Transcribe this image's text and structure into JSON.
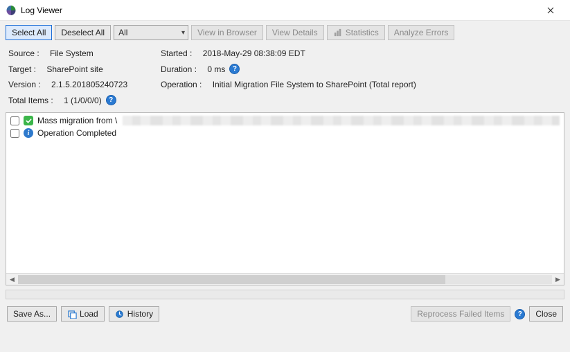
{
  "window": {
    "title": "Log Viewer"
  },
  "toolbar": {
    "select_all": "Select All",
    "deselect_all": "Deselect All",
    "filter_value": "All",
    "view_browser": "View in Browser",
    "view_details": "View Details",
    "statistics": "Statistics",
    "analyze_errors": "Analyze Errors"
  },
  "meta": {
    "source_label": "Source :",
    "source_value": "File System",
    "target_label": "Target :",
    "target_value": "SharePoint site",
    "version_label": "Version :",
    "version_value": "2.1.5.201805240723",
    "total_label": "Total Items :",
    "total_value": "1 (1/0/0/0)",
    "started_label": "Started :",
    "started_value": "2018-May-29 08:38:09 EDT",
    "duration_label": "Duration :",
    "duration_value": "0 ms",
    "operation_label": "Operation :",
    "operation_value": "Initial Migration File System to SharePoint (Total report)"
  },
  "log": {
    "items": [
      {
        "status": "success",
        "text": "Mass migration from \\",
        "redacted": true
      },
      {
        "status": "info",
        "text": "Operation Completed",
        "redacted": false
      }
    ]
  },
  "footer": {
    "save_as": "Save As...",
    "load": "Load",
    "history": "History",
    "reprocess": "Reprocess Failed Items",
    "close": "Close"
  },
  "colors": {
    "accent": "#1e6fd6",
    "success": "#3bb54a",
    "info": "#2e79cc"
  }
}
